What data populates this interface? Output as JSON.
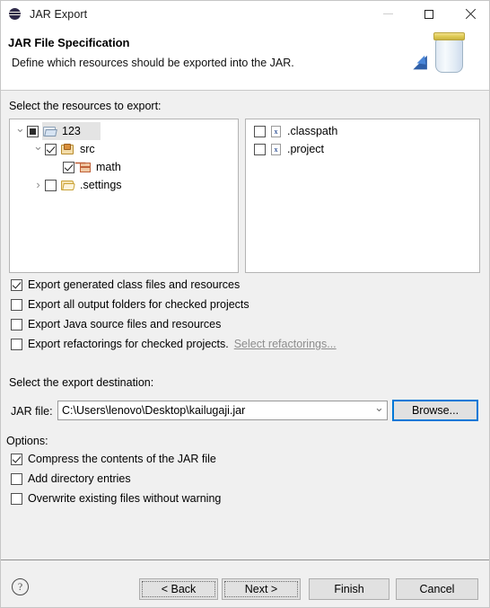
{
  "window": {
    "title": "JAR Export",
    "app_icon": "eclipse-icon",
    "controls": {
      "minimize": "minimize-icon",
      "maximize": "maximize-icon",
      "close": "close-icon"
    }
  },
  "header": {
    "title": "JAR File Specification",
    "description": "Define which resources should be exported into the JAR.",
    "banner_icon": "jar-export-icon"
  },
  "resources": {
    "label": "Select the resources to export:",
    "tree": [
      {
        "label": "123",
        "icon": "project-folder-icon",
        "check": "partial",
        "twisty": "open",
        "indent": 0,
        "selected": true
      },
      {
        "label": "src",
        "icon": "source-folder-icon",
        "check": "checked",
        "twisty": "open",
        "indent": 1,
        "selected": false
      },
      {
        "label": "math",
        "icon": "package-icon",
        "check": "checked",
        "twisty": "blank",
        "indent": 2,
        "selected": false
      },
      {
        "label": ".settings",
        "icon": "folder-icon",
        "check": "unchecked",
        "twisty": "closed",
        "indent": 1,
        "selected": false
      }
    ],
    "files": [
      {
        "label": ".classpath",
        "icon": "xml-file-icon",
        "check": "unchecked"
      },
      {
        "label": ".project",
        "icon": "xml-file-icon",
        "check": "unchecked"
      }
    ]
  },
  "export_options": [
    {
      "label": "Export generated class files and resources",
      "checked": true,
      "link": null
    },
    {
      "label": "Export all output folders for checked projects",
      "checked": false,
      "link": null
    },
    {
      "label": "Export Java source files and resources",
      "checked": false,
      "link": null
    },
    {
      "label": "Export refactorings for checked projects.",
      "checked": false,
      "link": "Select refactorings..."
    }
  ],
  "destination": {
    "label": "Select the export destination:",
    "jar_file_label": "JAR file:",
    "jar_file_value": "C:\\Users\\lenovo\\Desktop\\kailugaji.jar",
    "jar_file_placeholder": "",
    "browse_label": "Browse..."
  },
  "options": {
    "label": "Options:",
    "items": [
      {
        "label": "Compress the contents of the JAR file",
        "checked": true
      },
      {
        "label": "Add directory entries",
        "checked": false
      },
      {
        "label": "Overwrite existing files without warning",
        "checked": false
      }
    ]
  },
  "footer": {
    "help_icon": "help-icon",
    "buttons": [
      {
        "label": "< Back",
        "focus": "dotted"
      },
      {
        "label": "Next >",
        "focus": "dotted"
      },
      {
        "label": "Finish",
        "focus": "none"
      },
      {
        "label": "Cancel",
        "focus": "none"
      }
    ]
  },
  "colors": {
    "accent": "#0078d7",
    "dialog_bg": "#f0f0f0",
    "panel_bg": "#ffffff",
    "selection": "#e4e4e4",
    "disabled_link": "#8d8d8d"
  }
}
